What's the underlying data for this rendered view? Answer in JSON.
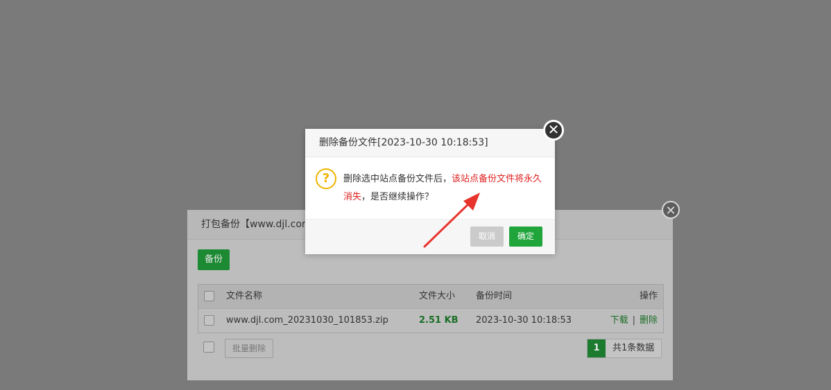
{
  "panel": {
    "title": "打包备份【www.djl.com",
    "close_glyph": "✕",
    "backup_label": "备份",
    "table": {
      "headers": {
        "name": "文件名称",
        "size": "文件大小",
        "time": "备份时间",
        "ops": "操作"
      },
      "rows": [
        {
          "name": "www.djl.com_20231030_101853.zip",
          "size": "2.51 KB",
          "time": "2023-10-30 10:18:53",
          "download": "下载",
          "separator": "|",
          "delete": "删除"
        }
      ]
    },
    "batch_delete_label": "批量删除",
    "pager": {
      "page": "1",
      "total": "共1条数据"
    }
  },
  "dialog": {
    "title": "删除备份文件[2023-10-30 10:18:53]",
    "close_glyph": "✕",
    "icon_glyph": "?",
    "message_part1": "删除选中站点备份文件后，",
    "message_warning": "该站点备份文件将永久消失",
    "message_part2": "，是否继续操作？",
    "cancel_label": "取消",
    "confirm_label": "确定"
  },
  "colors": {
    "accent": "#20a53a",
    "warning": "#e02020",
    "annotation_arrow": "#e8332d"
  },
  "icons": {
    "panel_close": "close-icon",
    "dialog_close": "close-icon",
    "dialog_icon": "question-icon",
    "annotation": "arrow-icon"
  }
}
